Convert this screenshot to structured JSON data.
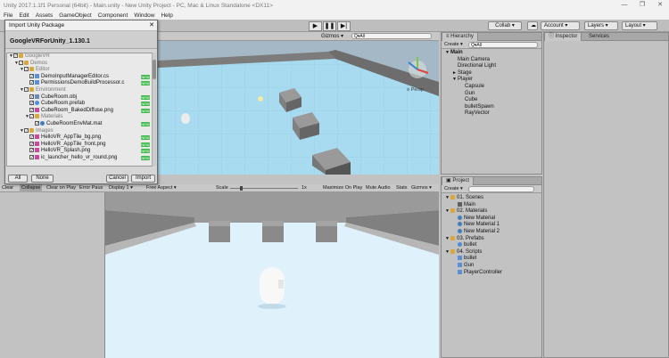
{
  "window": {
    "title": "Unity 2017.1.1f1 Personal (64bit) - Main.unity - New Unity Project - PC, Mac & Linux Standalone <DX11>",
    "minimize": "—",
    "restore": "❐",
    "close": "✕"
  },
  "menu": [
    "File",
    "Edit",
    "Assets",
    "GameObject",
    "Component",
    "Window",
    "Help"
  ],
  "toolbar": {
    "collab": "Collab ▾",
    "account": "Account",
    "layers": "Layers",
    "layout": "Layout"
  },
  "dialog": {
    "title": "Import Unity Package",
    "package": "GoogleVRForUnity_1.130.1",
    "items": [
      {
        "indent": 0,
        "fold": "▼",
        "icon": "folder",
        "label": "GoogleVR",
        "new": false
      },
      {
        "indent": 1,
        "fold": "▼",
        "icon": "folder",
        "label": "Demos",
        "new": false
      },
      {
        "indent": 2,
        "fold": "▼",
        "icon": "folder",
        "label": "Editor",
        "new": false
      },
      {
        "indent": 3,
        "fold": "",
        "icon": "script",
        "label": "DemoInputManagerEditor.cs",
        "new": true
      },
      {
        "indent": 3,
        "fold": "",
        "icon": "script",
        "label": "PermissionsDemoBuildProcessor.c",
        "new": true
      },
      {
        "indent": 2,
        "fold": "▼",
        "icon": "folder",
        "label": "Environment",
        "new": false
      },
      {
        "indent": 3,
        "fold": "",
        "icon": "mesh",
        "label": "CubeRoom.obj",
        "new": true
      },
      {
        "indent": 3,
        "fold": "",
        "icon": "prefab",
        "label": "CubeRoom.prefab",
        "new": true
      },
      {
        "indent": 3,
        "fold": "",
        "icon": "image",
        "label": "CubeRoom_BakedDiffuse.png",
        "new": true
      },
      {
        "indent": 3,
        "fold": "▼",
        "icon": "folder",
        "label": "Materials",
        "new": false
      },
      {
        "indent": 4,
        "fold": "",
        "icon": "material",
        "label": "CubeRoomEnvMat.mat",
        "new": true
      },
      {
        "indent": 2,
        "fold": "▼",
        "icon": "folder",
        "label": "Images",
        "new": false
      },
      {
        "indent": 3,
        "fold": "",
        "icon": "image",
        "label": "HelloVR_AppTile_bg.png",
        "new": true
      },
      {
        "indent": 3,
        "fold": "",
        "icon": "image",
        "label": "HelloVR_AppTile_front.png",
        "new": true
      },
      {
        "indent": 3,
        "fold": "",
        "icon": "image",
        "label": "HelloVR_Splash.png",
        "new": true
      },
      {
        "indent": 3,
        "fold": "",
        "icon": "image",
        "label": "ic_launcher_hello_vr_round.png",
        "new": true
      }
    ],
    "all": "All",
    "none": "None",
    "cancel": "Cancel",
    "import": "Import"
  },
  "scene": {
    "gizmos": "Gizmos ▾",
    "search": "Q▾All",
    "persp": "≡ Persp"
  },
  "console": {
    "clear": "Clear",
    "collapse": "Collapse",
    "clear_on_play": "Clear on Play",
    "error_pause": "Error Paus"
  },
  "game": {
    "display": "Display 1",
    "aspect": "Free Aspect",
    "scale_label": "Scale",
    "scale_value": "1x",
    "maximize": "Maximize On Play",
    "mute": "Mute Audio",
    "stats": "Stats",
    "gizmos": "Gizmos ▾",
    "scale_fraction": 0.15
  },
  "hierarchy": {
    "tab": "Hierarchy",
    "create": "Create ▾",
    "search": "Q▾All",
    "items": [
      {
        "indent": 0,
        "label": "Main",
        "bold": true,
        "fold": "▼"
      },
      {
        "indent": 1,
        "label": "Main Camera",
        "bold": false,
        "fold": ""
      },
      {
        "indent": 1,
        "label": "Directional Light",
        "bold": false,
        "fold": ""
      },
      {
        "indent": 1,
        "label": "Stage",
        "bold": false,
        "fold": "►"
      },
      {
        "indent": 1,
        "label": "Player",
        "bold": false,
        "fold": "▼"
      },
      {
        "indent": 2,
        "label": "Capsule",
        "bold": false,
        "fold": ""
      },
      {
        "indent": 2,
        "label": "Gun",
        "bold": false,
        "fold": ""
      },
      {
        "indent": 2,
        "label": "Cube",
        "bold": false,
        "fold": ""
      },
      {
        "indent": 2,
        "label": "bulletSpawn",
        "bold": false,
        "fold": ""
      },
      {
        "indent": 2,
        "label": "RayVector",
        "bold": false,
        "fold": ""
      }
    ]
  },
  "project": {
    "tab": "Project",
    "create": "Create ▾",
    "items": [
      {
        "indent": 0,
        "icon": "folder",
        "label": "01. Scenes",
        "fold": "▼"
      },
      {
        "indent": 1,
        "icon": "scene",
        "label": "Main",
        "fold": ""
      },
      {
        "indent": 0,
        "icon": "folder",
        "label": "02. Materials",
        "fold": "▼"
      },
      {
        "indent": 1,
        "icon": "material",
        "label": "New Material",
        "fold": ""
      },
      {
        "indent": 1,
        "icon": "material",
        "label": "New Material 1",
        "fold": ""
      },
      {
        "indent": 1,
        "icon": "material",
        "label": "New Material 2",
        "fold": ""
      },
      {
        "indent": 0,
        "icon": "folder",
        "label": "03. Prefabs",
        "fold": "▼"
      },
      {
        "indent": 1,
        "icon": "prefab",
        "label": "bullet",
        "fold": ""
      },
      {
        "indent": 0,
        "icon": "folder",
        "label": "04. Scripts",
        "fold": "▼"
      },
      {
        "indent": 1,
        "icon": "script",
        "label": "bullet",
        "fold": ""
      },
      {
        "indent": 1,
        "icon": "script",
        "label": "Gun",
        "fold": ""
      },
      {
        "indent": 1,
        "icon": "script",
        "label": "PlayerController",
        "fold": ""
      }
    ]
  },
  "inspector": {
    "tab": "Inspector",
    "services": "Services"
  },
  "colors": {
    "folder": "#d9a83c",
    "script": "#5a8fd6",
    "mesh": "#6b8cb8",
    "prefab": "#4a8fd8",
    "image": "#c84b9b",
    "material": "#3f7fbf",
    "scene": "#5e5e5e"
  }
}
